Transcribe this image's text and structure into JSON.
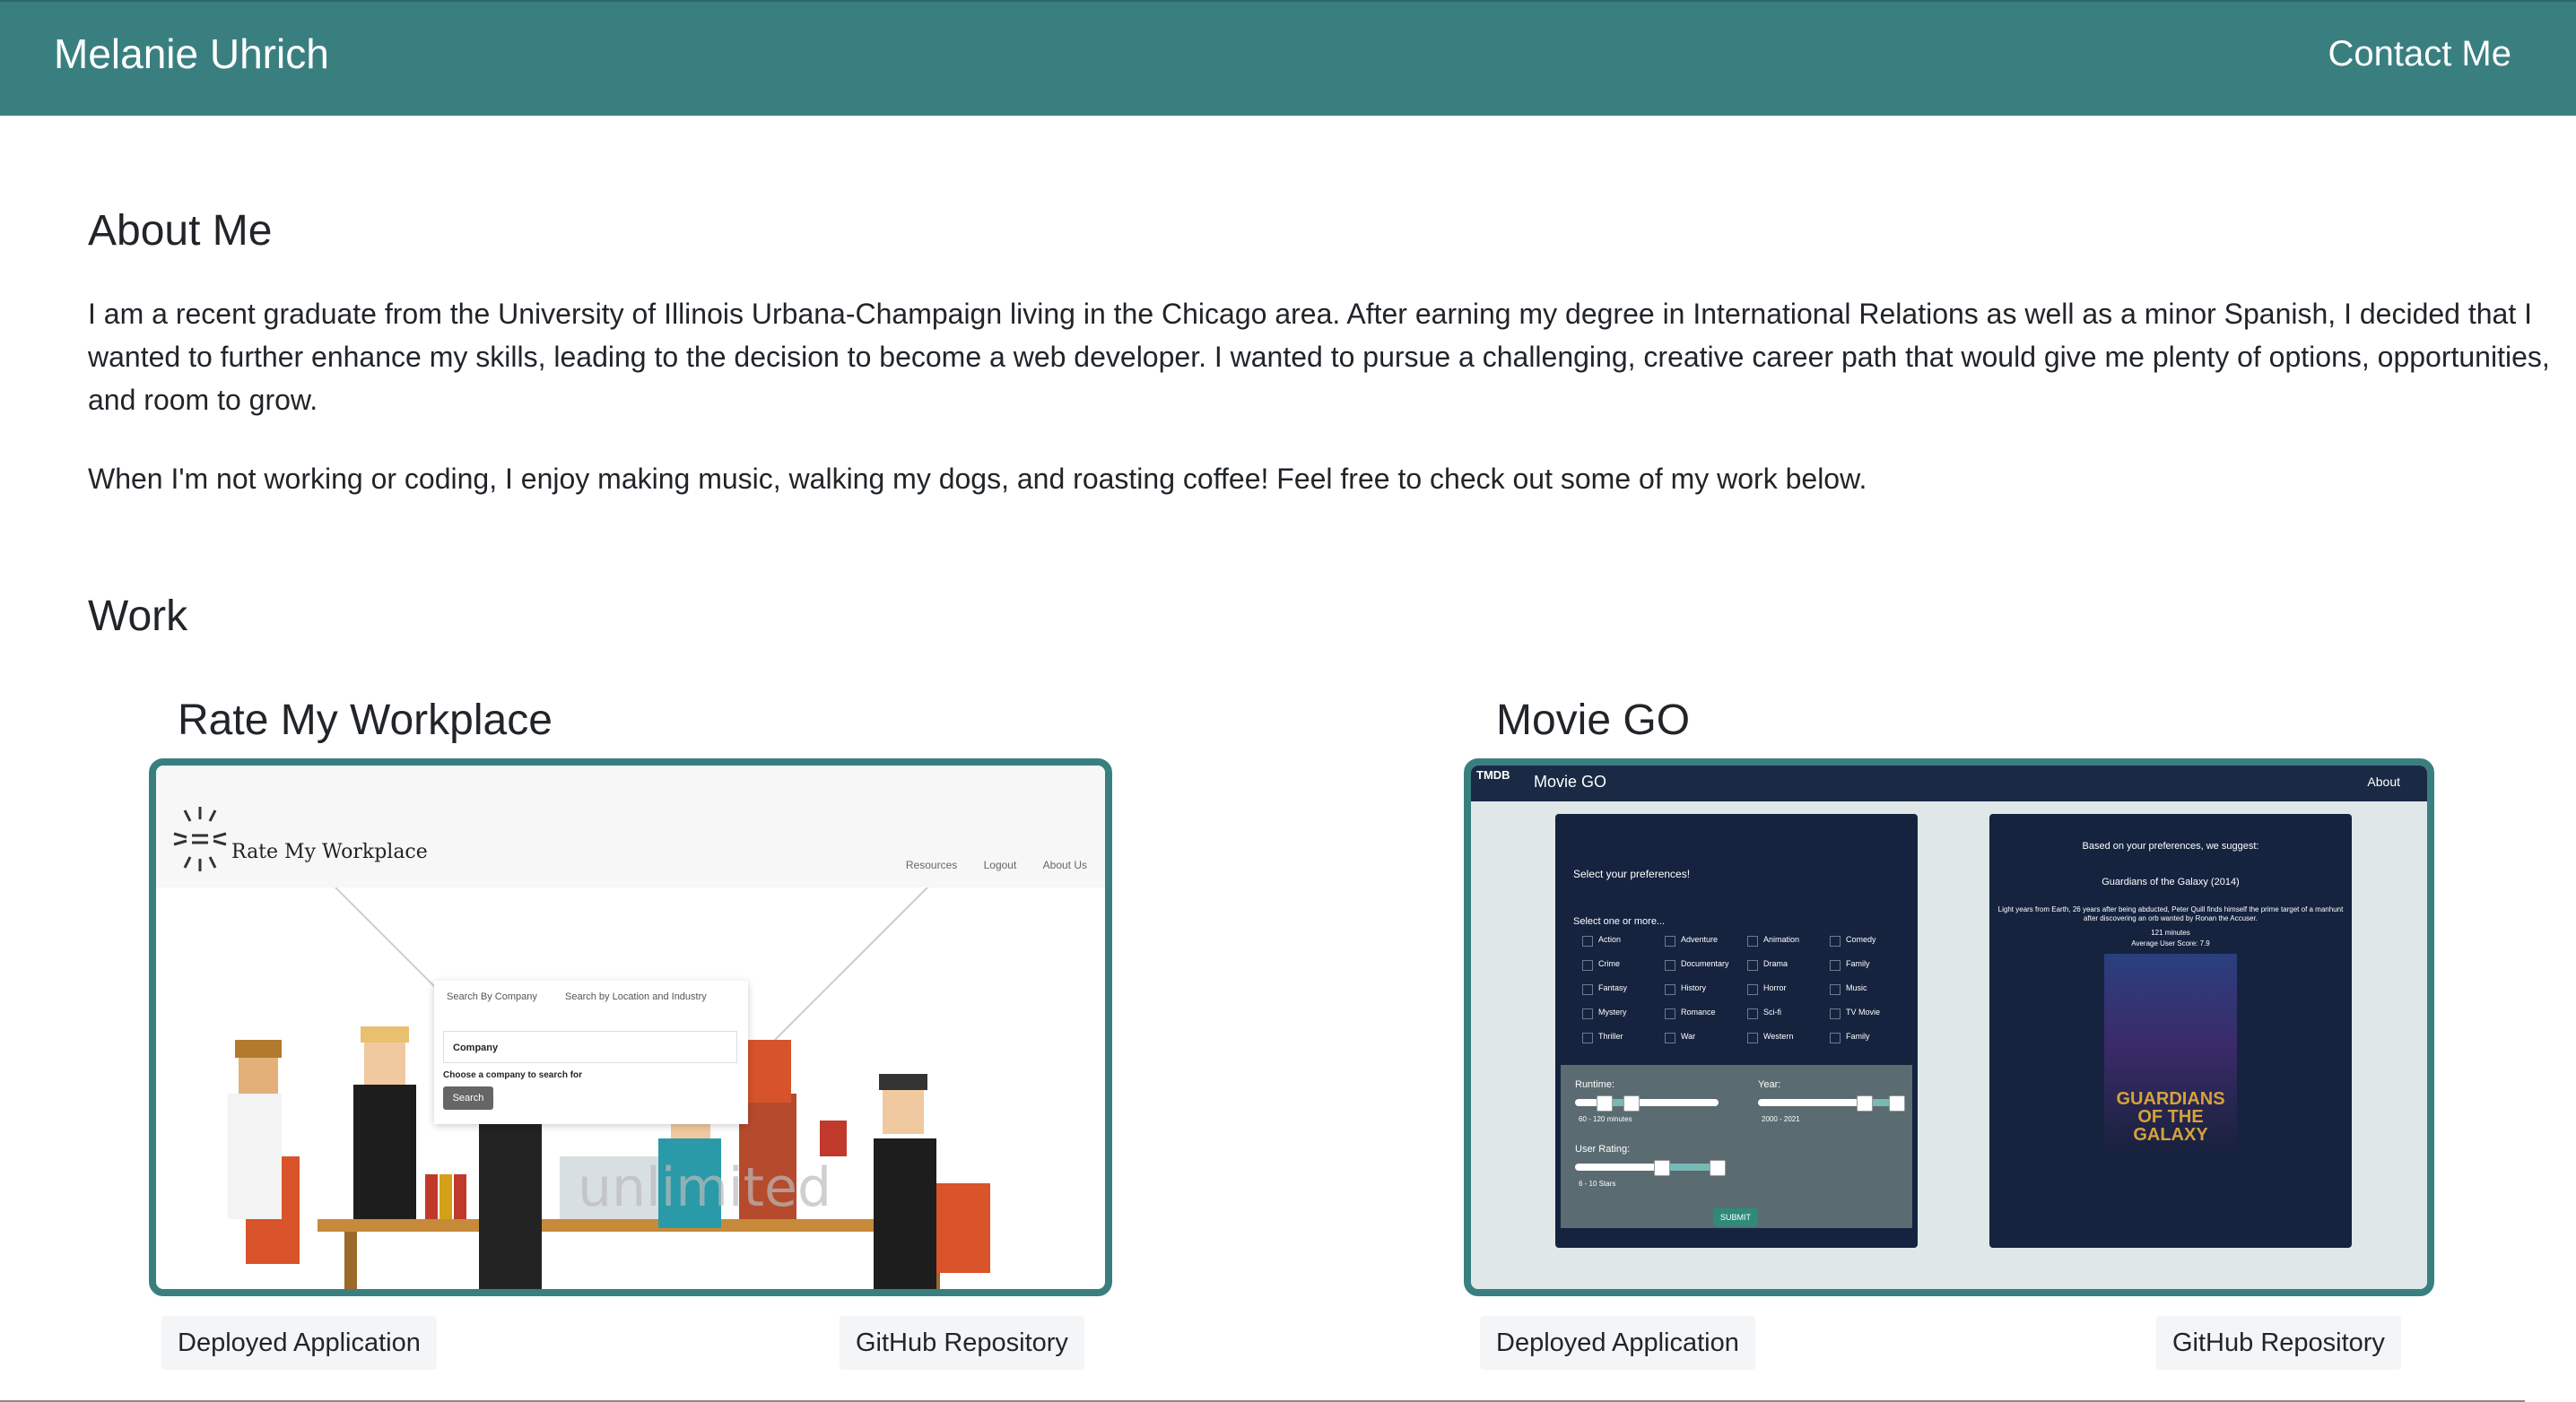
{
  "navbar": {
    "brand": "Melanie Uhrich",
    "contact": "Contact Me",
    "background_color": "#3a7f80"
  },
  "about": {
    "heading": "About Me",
    "paragraph1": "I am a recent graduate from the University of Illinois Urbana-Champaign living in the Chicago area. After earning my degree in International Relations as well as a minor Spanish, I decided that I wanted to further enhance my skills, leading to the decision to become a web developer. I wanted to pursue a challenging, creative career path that would give me plenty of options, opportunities, and room to grow.",
    "paragraph2": "When I'm not working or coding, I enjoy making music, walking my dogs, and roasting coffee! Feel free to check out some of my work below."
  },
  "work": {
    "heading": "Work",
    "projects": [
      {
        "title": "Rate My Workplace",
        "deployed_label": "Deployed Application",
        "github_label": "GitHub Repository",
        "screenshot": {
          "logo_text": "Rate My Workplace",
          "nav_links": [
            "Resources",
            "Logout",
            "About Us"
          ],
          "tab1": "Search By Company",
          "tab2": "Search by Location and Industry",
          "input_value": "Company",
          "hint": "Choose a company to search for",
          "search_button": "Search",
          "watermark": "unlimited"
        }
      },
      {
        "title": "Movie GO",
        "deployed_label": "Deployed Application",
        "github_label": "GitHub Repository",
        "screenshot": {
          "logo_badge": "TMDB",
          "app_title": "Movie GO",
          "nav_about": "About",
          "prefs_title": "Select your preferences!",
          "select_hint": "Select one or more...",
          "genres": [
            "Action",
            "Adventure",
            "Animation",
            "Comedy",
            "Crime",
            "Documentary",
            "Drama",
            "Family",
            "Fantasy",
            "History",
            "Horror",
            "Music",
            "Mystery",
            "Romance",
            "Sci-fi",
            "TV Movie",
            "Thriller",
            "War",
            "Western",
            "Family"
          ],
          "runtime_label": "Runtime:",
          "runtime_value": "60 - 120 minutes",
          "year_label": "Year:",
          "year_value": "2000 - 2021",
          "rating_label": "User Rating:",
          "rating_value": "6 - 10 Stars",
          "submit_label": "SUBMIT",
          "suggest_heading": "Based on your preferences, we suggest:",
          "movie_title": "Guardians of the Galaxy (2014)",
          "movie_desc": "Light years from Earth, 26 years after being abducted, Peter Quill finds himself the prime target of a manhunt after discovering an orb wanted by Ronan the Accuser.",
          "movie_runtime": "121 minutes",
          "movie_score": "Average User Score: 7.9",
          "poster_text": "GUARDIANS OF THE GALAXY"
        }
      }
    ]
  }
}
